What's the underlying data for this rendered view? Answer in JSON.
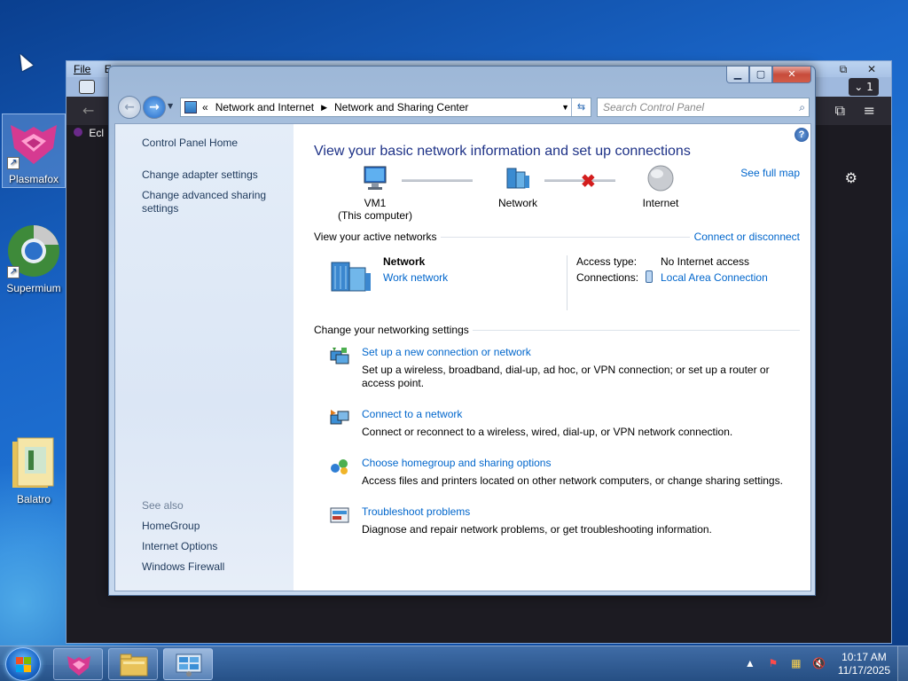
{
  "desktop": {
    "icons": [
      {
        "label": "Plasmafox"
      },
      {
        "label": "Supermium"
      },
      {
        "label": "Balatro"
      }
    ]
  },
  "browser": {
    "menu_file": "File",
    "menu_edit": "E",
    "side_tab": "Ecl",
    "tab_count": "1",
    "btn_min": "⧉",
    "btn_close": "✕"
  },
  "window": {
    "address": {
      "overflow": "«",
      "crumb1": "Network and Internet",
      "crumb2": "Network and Sharing Center"
    },
    "search_placeholder": "Search Control Panel",
    "left_pane": {
      "home": "Control Panel Home",
      "adapter": "Change adapter settings",
      "sharing_line1": "Change advanced sharing",
      "sharing_line2": "settings",
      "see_also": "See also",
      "homegroup": "HomeGroup",
      "internet_options": "Internet Options",
      "firewall": "Windows Firewall"
    },
    "main": {
      "heading": "View your basic network information and set up connections",
      "see_full_map": "See full map",
      "nodes": {
        "computer_name": "VM1",
        "computer_sub": "(This computer)",
        "network": "Network",
        "internet": "Internet"
      },
      "active_networks_label": "View your active networks",
      "connect_disconnect": "Connect or disconnect",
      "network_name": "Network",
      "network_type": "Work network",
      "access_type_label": "Access type:",
      "access_type_value": "No Internet access",
      "connections_label": "Connections:",
      "connections_value": "Local Area Connection",
      "change_settings_label": "Change your networking settings",
      "tasks": [
        {
          "title": "Set up a new connection or network",
          "desc": "Set up a wireless, broadband, dial-up, ad hoc, or VPN connection; or set up a router or access point."
        },
        {
          "title": "Connect to a network",
          "desc": "Connect or reconnect to a wireless, wired, dial-up, or VPN network connection."
        },
        {
          "title": "Choose homegroup and sharing options",
          "desc": "Access files and printers located on other network computers, or change sharing settings."
        },
        {
          "title": "Troubleshoot problems",
          "desc": "Diagnose and repair network problems, or get troubleshooting information."
        }
      ]
    }
  },
  "taskbar": {
    "time": "10:17 AM",
    "date": "11/17/2025"
  },
  "colors": {
    "link": "#0066cc",
    "heading": "#1e3287",
    "left_pane_text": "#1e395b",
    "error_x": "#d31d1d"
  }
}
